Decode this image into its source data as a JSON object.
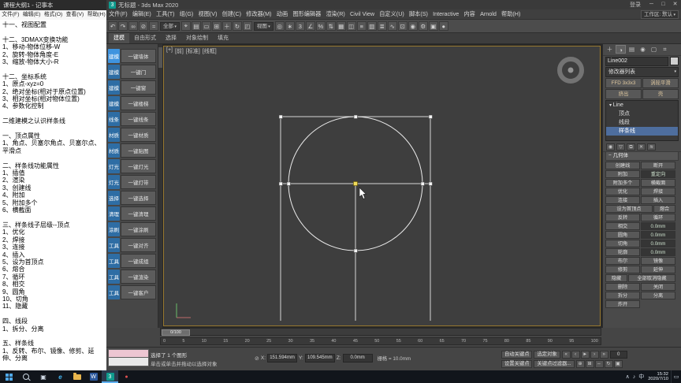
{
  "notepad": {
    "title": "课程大纲1 - 记事本",
    "menus": [
      "文件(F)",
      "编辑(E)",
      "格式(O)",
      "查看(V)",
      "帮助(H)"
    ],
    "lines": [
      "十一、视图配置",
      "",
      "十二、3DMAX变换功能",
      "1、移动-物体位移-W",
      "2、旋转-物体角度-E",
      "3、缩放-物体大小-R",
      "",
      "十二、坐标系统",
      "1、原点-xyz=0",
      "2、绝对坐标(相对于原点位置)",
      "3、相对坐标(相对物体位置)",
      "4、参数化控制",
      "",
      "二维建模之认识样条线",
      "",
      "一、顶点属性",
      "1、角点、贝塞尔角点、贝塞尔点、平滑点",
      "",
      "二、样条线功能属性",
      "1、插值",
      "2、渲染",
      "3、创建线",
      "4、附加",
      "5、附加多个",
      "6、横截面",
      "",
      "三、样条线子层级--顶点",
      "1、优化",
      "2、焊接",
      "3、连接",
      "4、插入",
      "5、设为首顶点",
      "6、熔合",
      "7、循环",
      "8、相交",
      "9、圆角",
      "10、切角",
      "11、隐藏",
      "",
      "四、线段",
      "1、拆分、分离",
      "",
      "五、样条线",
      "1、反转、布尔、镜像、修剪、延伸、分离"
    ]
  },
  "max": {
    "titlebar": {
      "logo": "3",
      "title": "无标题 - 3ds Max 2020",
      "signin": "登录",
      "buttons": [
        {
          "g": "─",
          "name": "minimize-button"
        },
        {
          "g": "□",
          "name": "maximize-button"
        },
        {
          "g": "✕",
          "name": "close-button"
        }
      ]
    },
    "menus": [
      "文件(F)",
      "编辑(E)",
      "工具(T)",
      "组(G)",
      "视图(V)",
      "创建(C)",
      "修改器(M)",
      "动画",
      "图形编辑器",
      "渲染(R)",
      "Civil View",
      "自定义(U)",
      "脚本(S)",
      "Interactive",
      "内容",
      "Arnold",
      "帮助(H)"
    ],
    "workspace": "工作区: 默认",
    "toolbar": {
      "icons1": [
        {
          "g": "↶",
          "name": "undo-icon"
        },
        {
          "g": "↷",
          "name": "redo-icon"
        },
        {
          "g": "∞",
          "name": "select-and-link-icon"
        },
        {
          "g": "⊘",
          "name": "unlink-selection-icon"
        },
        {
          "g": "≈",
          "name": "bind-to-spacewarp-icon"
        }
      ],
      "filter": "全部",
      "icons2": [
        {
          "g": "⌖",
          "name": "select-object-icon"
        },
        {
          "g": "▤",
          "name": "select-by-name-icon"
        },
        {
          "g": "▭",
          "name": "rectangular-selection-icon"
        },
        {
          "g": "⊞",
          "name": "window-crossing-icon"
        },
        {
          "g": "＋",
          "name": "select-and-move-icon"
        },
        {
          "g": "↻",
          "name": "select-and-rotate-icon"
        },
        {
          "g": "◰",
          "name": "select-and-scale-icon"
        }
      ],
      "coord": "视图",
      "icons3": [
        {
          "g": "◎",
          "name": "use-pivot-center-icon"
        },
        {
          "g": "∗",
          "name": "select-and-manipulate-icon"
        },
        {
          "g": "3",
          "name": "snap-toggle-icon"
        },
        {
          "g": "∠",
          "name": "angle-snap-icon"
        },
        {
          "g": "%",
          "name": "percent-snap-icon"
        },
        {
          "g": "⇅",
          "name": "spinner-snap-icon"
        },
        {
          "g": "▦",
          "name": "edit-named-selection-icon"
        },
        {
          "g": "◫",
          "name": "mirror-icon"
        },
        {
          "g": "≡",
          "name": "align-icon"
        },
        {
          "g": "▥",
          "name": "scene-explorer-icon"
        },
        {
          "g": "≣",
          "name": "layer-explorer-icon"
        },
        {
          "g": "∿",
          "name": "curve-editor-icon"
        },
        {
          "g": "⊡",
          "name": "schematic-view-icon"
        },
        {
          "g": "◉",
          "name": "material-editor-icon"
        },
        {
          "g": "⚙",
          "name": "render-setup-icon"
        },
        {
          "g": "▣",
          "name": "rendered-frame-icon"
        },
        {
          "g": "●",
          "name": "render-production-icon"
        }
      ]
    },
    "ribbon_tabs": [
      {
        "t": "建模",
        "cls": "active"
      },
      {
        "t": "自由形式"
      },
      {
        "t": "选择"
      },
      {
        "t": "对象绘制"
      },
      {
        "t": "填充"
      }
    ],
    "plugin_rows": [
      {
        "cat": "建模",
        "btn": "一键墙体",
        "cls": "active"
      },
      {
        "cat": "建模",
        "btn": "一键门"
      },
      {
        "cat": "建模",
        "btn": "一键窗"
      },
      {
        "cat": "建模",
        "btn": "一键楼梯"
      },
      {
        "cat": "线条",
        "btn": "一键线条"
      },
      {
        "cat": "材质",
        "btn": "一键材质"
      },
      {
        "cat": "材质",
        "btn": "一键贴图"
      },
      {
        "cat": "灯光",
        "btn": "一键灯光"
      },
      {
        "cat": "灯光",
        "btn": "一键灯带"
      },
      {
        "cat": "选择",
        "btn": "一键选择"
      },
      {
        "cat": "清理",
        "btn": "一键清理"
      },
      {
        "cat": "涂刷",
        "btn": "一键涂刷"
      },
      {
        "cat": "工具",
        "btn": "一键对齐"
      },
      {
        "cat": "工具",
        "btn": "一键成组"
      },
      {
        "cat": "工具",
        "btn": "一键渲染"
      },
      {
        "cat": "工具",
        "btn": "一键客户"
      }
    ],
    "viewport": {
      "labels": [
        {
          "t": "[+]"
        },
        {
          "t": "[前]"
        },
        {
          "t": "[标准]"
        },
        {
          "t": "[线框]"
        }
      ]
    },
    "command": {
      "tabs": [
        {
          "g": "＋",
          "name": "create-tab"
        },
        {
          "g": "◑",
          "name": "modify-tab",
          "cls": "active"
        },
        {
          "g": "▤",
          "name": "hierarchy-tab"
        },
        {
          "g": "◉",
          "name": "motion-tab"
        },
        {
          "g": "▢",
          "name": "display-tab"
        },
        {
          "g": "⌗",
          "name": "utilities-tab"
        }
      ],
      "object_name": "Line002",
      "modifier_list": "修改器列表",
      "quick_mods": [
        {
          "t": "FFD 3x3x3"
        },
        {
          "t": "涡轮平滑"
        },
        {
          "t": "挤出"
        },
        {
          "t": "壳"
        }
      ],
      "stack_root": "Line",
      "stack_children": [
        {
          "t": "顶点"
        },
        {
          "t": "线段"
        },
        {
          "t": "样条线",
          "cls": "sel"
        }
      ],
      "stack_tools": [
        {
          "g": "◉",
          "name": "pin-stack-icon"
        },
        {
          "g": "▽",
          "name": "show-end-result-icon"
        },
        {
          "g": "⧉",
          "name": "make-unique-icon"
        },
        {
          "g": "✕",
          "name": "remove-modifier-icon"
        },
        {
          "g": "≋",
          "name": "configure-modifier-sets-icon"
        }
      ],
      "rollout_title": "几何体",
      "geometry_items": [
        {
          "t": "创建线"
        },
        {
          "t": "断开"
        },
        {
          "t": "附加"
        },
        {
          "t": "重定向",
          "cls": "spin"
        },
        {
          "t": "附加多个"
        },
        {
          "t": "横截面"
        },
        {
          "t": "优化"
        },
        {
          "t": "焊接"
        },
        {
          "t": "连接"
        },
        {
          "t": "插入"
        },
        {
          "t": "设为首顶点",
          "cls": "lg"
        },
        {
          "t": "熔合",
          "cls": "sm"
        },
        {
          "t": "反转"
        },
        {
          "t": "循环"
        },
        {
          "t": "相交"
        },
        {
          "t": "0.0mm",
          "cls": "spin"
        },
        {
          "t": "圆角"
        },
        {
          "t": "0.0mm",
          "cls": "spin"
        },
        {
          "t": "切角"
        },
        {
          "t": "0.0mm",
          "cls": "spin"
        },
        {
          "t": "轮廓"
        },
        {
          "t": "0.0mm",
          "cls": "spin"
        },
        {
          "t": "布尔"
        },
        {
          "t": "镜像"
        },
        {
          "t": "修剪"
        },
        {
          "t": "延伸"
        },
        {
          "t": "隐藏",
          "cls": "sm"
        },
        {
          "t": "全部取消隐藏",
          "cls": "lg"
        },
        {
          "t": "删除"
        },
        {
          "t": "关闭"
        },
        {
          "t": "拆分"
        },
        {
          "t": "分离"
        },
        {
          "t": "炸开"
        }
      ]
    },
    "timeline": {
      "handle": "0/100",
      "ticks": [
        "0",
        "5",
        "10",
        "15",
        "20",
        "25",
        "30",
        "35",
        "40",
        "45",
        "50",
        "55",
        "60",
        "65",
        "70",
        "75",
        "80",
        "85",
        "90",
        "95",
        "100"
      ]
    },
    "status": {
      "line1": "选择了 1 个图形",
      "prompt": "单击或单击并拖动以选择对象",
      "lock_glyph": "⊘",
      "x_label": "X:",
      "x": "151.594mm",
      "y_label": "Y:",
      "y": "109.545mm",
      "z_label": "Z:",
      "z": "0.0mm",
      "grid": "栅格 = 10.0mm",
      "autokey": "自动关键点",
      "setkey": "设置关键点",
      "selset": "选定对象",
      "keyfilter": "关键点过滤器...",
      "frame": "0",
      "playback": [
        {
          "g": "«",
          "name": "go-to-start-icon"
        },
        {
          "g": "‹",
          "name": "previous-frame-icon"
        },
        {
          "g": "►",
          "name": "play-icon"
        },
        {
          "g": "›",
          "name": "next-frame-icon"
        },
        {
          "g": "»",
          "name": "go-to-end-icon"
        }
      ],
      "nav": [
        {
          "g": "⊕",
          "name": "zoom-icon"
        },
        {
          "g": "⊞",
          "name": "zoom-extents-icon"
        },
        {
          "g": "⇔",
          "name": "pan-icon"
        },
        {
          "g": "↻",
          "name": "orbit-icon"
        },
        {
          "g": "▣",
          "name": "maximize-viewport-toggle-icon"
        }
      ]
    }
  },
  "taskbar": {
    "taskview_glyph": "▣",
    "apps": [
      {
        "g": "e",
        "name": "edge-icon",
        "cls": "edge"
      },
      {
        "g": "",
        "name": "file-explorer-icon",
        "cls": "folder"
      },
      {
        "g": "W",
        "name": "word-icon",
        "cls": "word"
      },
      {
        "g": "3",
        "name": "max-taskbar-icon",
        "cls": "maxapp active"
      },
      {
        "g": "●",
        "name": "screen-recorder-icon",
        "cls": "rec"
      }
    ],
    "tray": [
      {
        "g": "∧",
        "name": "tray-expand-icon"
      },
      {
        "g": "♪",
        "name": "volume-icon"
      },
      {
        "g": "中",
        "name": "ime-indicator"
      }
    ],
    "time": "15:32",
    "date": "2020/7/10",
    "notif_glyph": "▭"
  }
}
